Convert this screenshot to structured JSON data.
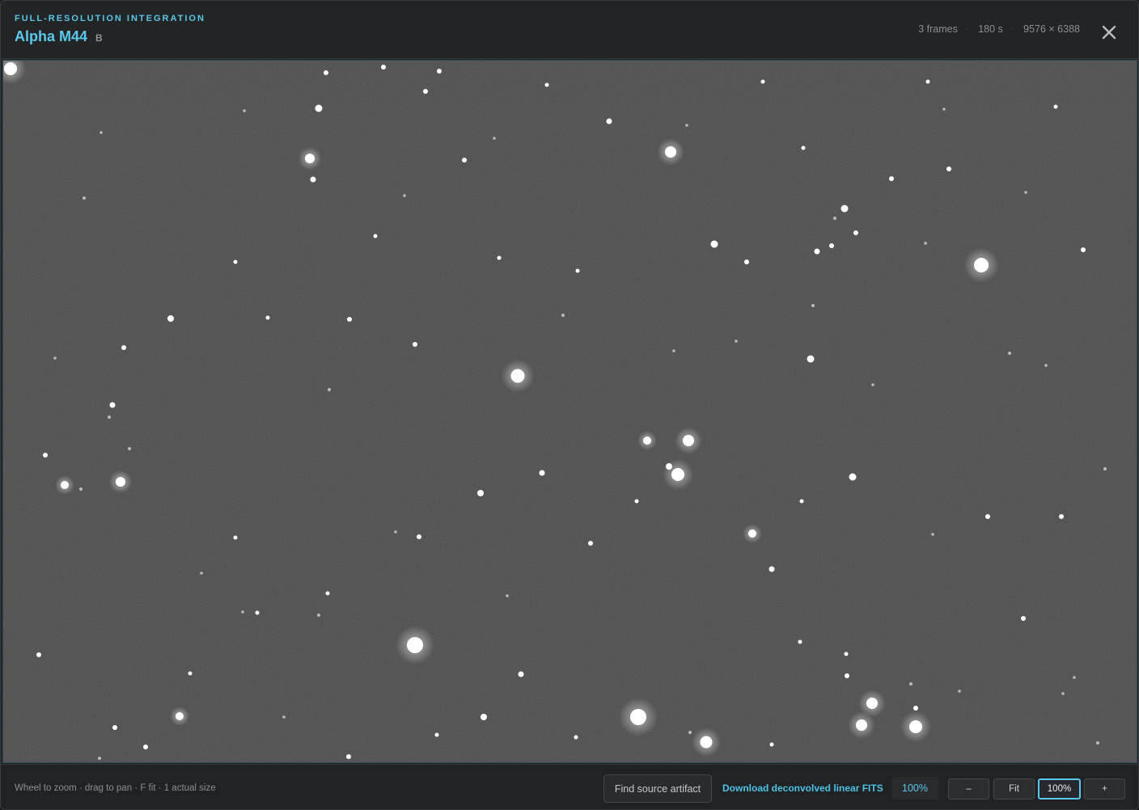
{
  "header": {
    "kicker": "FULL-RESOLUTION INTEGRATION",
    "title": "Alpha M44",
    "filter": "B",
    "meta": [
      "3 frames",
      "180 s",
      "9576 × 6388"
    ],
    "meta_separator": "·"
  },
  "icons": {
    "close": "close-icon"
  },
  "footer": {
    "hint": "Wheel to zoom · drag to pan · F fit · 1 actual size",
    "find_source_label": "Find source artifact",
    "download_label": "Download deconvolved linear FITS",
    "zoom_readout": "100%",
    "zoom_out_label": "–",
    "fit_label": "Fit",
    "actual_label": "100%",
    "zoom_in_label": "+"
  },
  "colors": {
    "accent": "#5cc8ec",
    "sky_background": "#3c3c3c",
    "star": "#ffffff"
  }
}
